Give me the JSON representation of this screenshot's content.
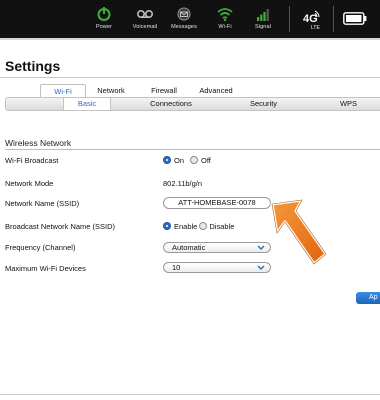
{
  "status_bar": {
    "items": [
      {
        "label": "Power",
        "icon": "power-icon",
        "color": "#3fae3f"
      },
      {
        "label": "Voicemail",
        "icon": "voicemail-icon",
        "color": "#bdbdbd"
      },
      {
        "label": "Messages",
        "icon": "messages-icon",
        "color": "#bdbdbd"
      },
      {
        "label": "Wi-Fi",
        "icon": "wifi-icon",
        "color": "#3fae3f"
      },
      {
        "label": "Signal",
        "icon": "signal-icon",
        "color": "#3fae3f"
      }
    ],
    "network_icon": "4g-lte-icon",
    "battery_icon": "battery-icon"
  },
  "page": {
    "title": "Settings"
  },
  "tabs": {
    "primary": [
      "Wi-Fi",
      "Network",
      "Firewall",
      "Advanced"
    ],
    "primary_active": "Wi-Fi",
    "secondary": [
      "Basic",
      "Connections",
      "Security",
      "WPS"
    ],
    "secondary_active": "Basic"
  },
  "wireless": {
    "section_title": "Wireless Network",
    "broadcast": {
      "label": "Wi-Fi Broadcast",
      "options": [
        "On",
        "Off"
      ],
      "selected": "On"
    },
    "mode": {
      "label": "Network Mode",
      "value": "802.11b/g/n"
    },
    "ssid": {
      "label": "Network Name (SSID)",
      "value": "ATT-HOMEBASE-0078"
    },
    "broadcast_ssid": {
      "label": "Broadcast Network Name (SSID)",
      "options": [
        "Enable",
        "Disable"
      ],
      "selected": "Enable"
    },
    "channel": {
      "label": "Frequency (Channel)",
      "value": "Automatic"
    },
    "max_devices": {
      "label": "Maximum Wi-Fi Devices",
      "value": "10"
    }
  },
  "apply_label": "Ap",
  "colors": {
    "accent": "#2a6ebb",
    "arrow": "#f07d1d",
    "topbar": "#111111"
  }
}
